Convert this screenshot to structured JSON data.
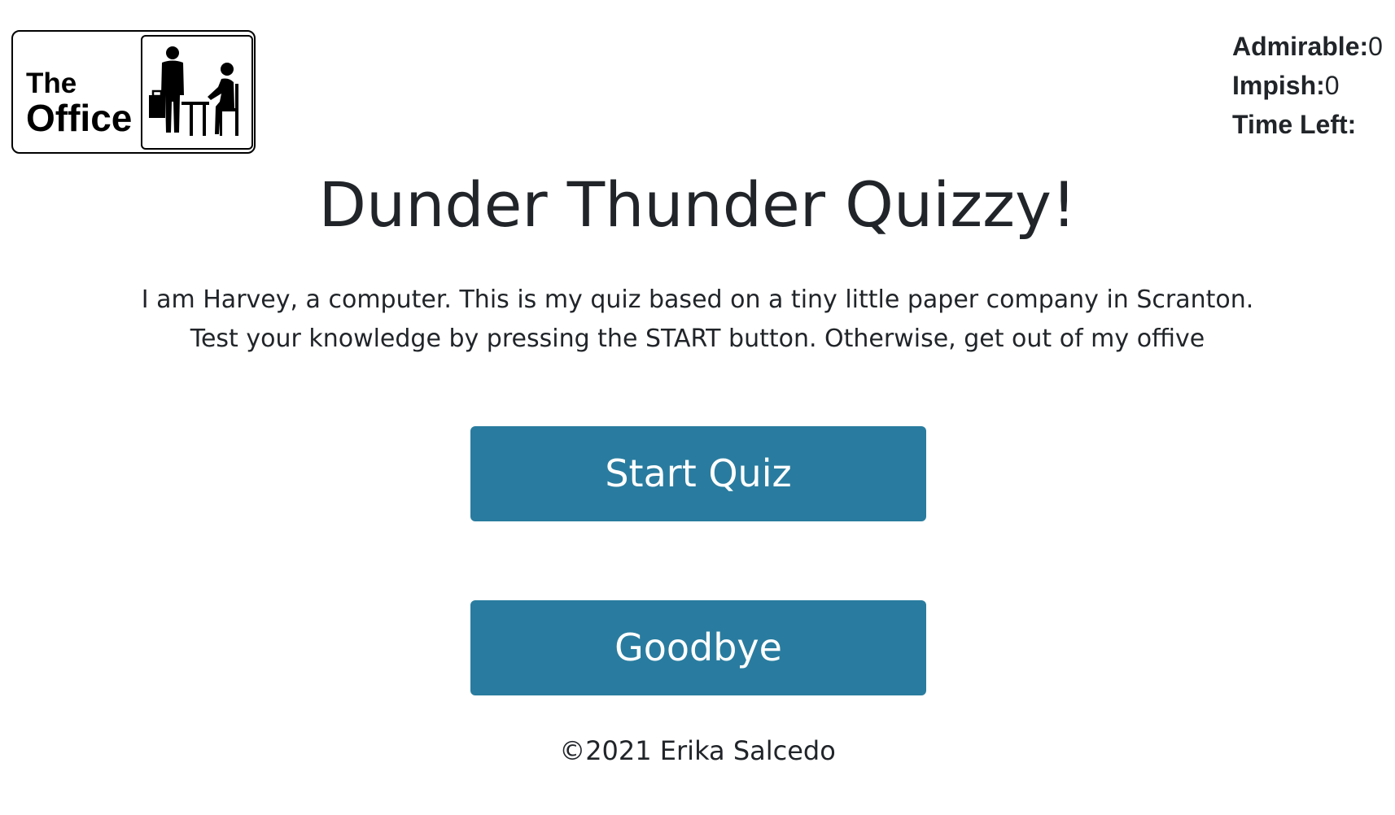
{
  "logo": {
    "line1": "The",
    "line2": "Office"
  },
  "scores": {
    "admirable_label": "Admirable:",
    "admirable_value": "0",
    "impish_label": "Impish:",
    "impish_value": "0",
    "time_left_label": "Time Left:",
    "time_left_value": ""
  },
  "page": {
    "title": "Dunder Thunder Quizzy!",
    "intro": "I am Harvey, a computer. This is my quiz based on a tiny little paper company in Scranton. Test your knowledge by pressing the START button. Otherwise, get out of my offive"
  },
  "buttons": {
    "start_label": "Start Quiz",
    "goodbye_label": "Goodbye"
  },
  "footer": {
    "copyright": "©2021 Erika Salcedo"
  },
  "colors": {
    "button_bg": "#297c9f",
    "button_text": "#ffffff",
    "text": "#212529"
  },
  "icons": {
    "logo_pictogram": "office-workers-icon"
  }
}
